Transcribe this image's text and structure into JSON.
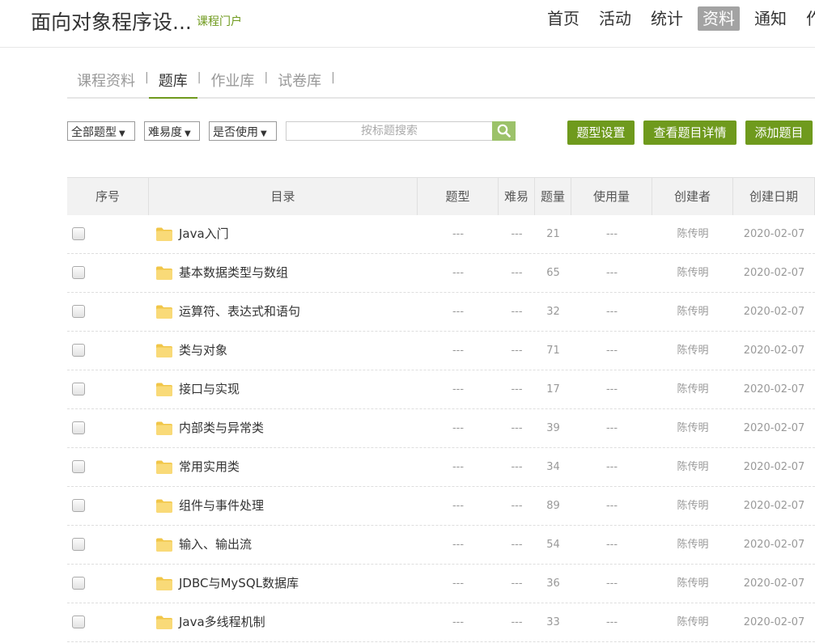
{
  "header": {
    "course_title": "面向对象程序设...",
    "portal_link": "课程门户",
    "nav": [
      "首页",
      "活动",
      "统计",
      "资料",
      "通知",
      "作"
    ],
    "active_nav": 3
  },
  "subtabs": {
    "items": [
      "课程资料",
      "题库",
      "作业库",
      "试卷库"
    ],
    "separator": "|",
    "active": 1
  },
  "filters": {
    "type_select": "全部题型",
    "difficulty_select": "难易度",
    "usage_select": "是否使用",
    "caret": "▼",
    "search_placeholder": "按标题搜索"
  },
  "actions": {
    "type_settings": "题型设置",
    "view_details": "查看题目详情",
    "add_question": "添加题目"
  },
  "table": {
    "columns": [
      "序号",
      "目录",
      "题型",
      "难易",
      "题量",
      "使用量",
      "创建者",
      "创建日期"
    ],
    "rows": [
      {
        "name": "Java入门",
        "type": "---",
        "difficulty": "---",
        "count": "21",
        "usage": "---",
        "creator": "陈传明",
        "date": "2020-02-07"
      },
      {
        "name": "基本数据类型与数组",
        "type": "---",
        "difficulty": "---",
        "count": "65",
        "usage": "---",
        "creator": "陈传明",
        "date": "2020-02-07"
      },
      {
        "name": "运算符、表达式和语句",
        "type": "---",
        "difficulty": "---",
        "count": "32",
        "usage": "---",
        "creator": "陈传明",
        "date": "2020-02-07"
      },
      {
        "name": "类与对象",
        "type": "---",
        "difficulty": "---",
        "count": "71",
        "usage": "---",
        "creator": "陈传明",
        "date": "2020-02-07"
      },
      {
        "name": "接口与实现",
        "type": "---",
        "difficulty": "---",
        "count": "17",
        "usage": "---",
        "creator": "陈传明",
        "date": "2020-02-07"
      },
      {
        "name": "内部类与异常类",
        "type": "---",
        "difficulty": "---",
        "count": "39",
        "usage": "---",
        "creator": "陈传明",
        "date": "2020-02-07"
      },
      {
        "name": "常用实用类",
        "type": "---",
        "difficulty": "---",
        "count": "34",
        "usage": "---",
        "creator": "陈传明",
        "date": "2020-02-07"
      },
      {
        "name": "组件与事件处理",
        "type": "---",
        "difficulty": "---",
        "count": "89",
        "usage": "---",
        "creator": "陈传明",
        "date": "2020-02-07"
      },
      {
        "name": "输入、输出流",
        "type": "---",
        "difficulty": "---",
        "count": "54",
        "usage": "---",
        "creator": "陈传明",
        "date": "2020-02-07"
      },
      {
        "name": "JDBC与MySQL数据库",
        "type": "---",
        "difficulty": "---",
        "count": "36",
        "usage": "---",
        "creator": "陈传明",
        "date": "2020-02-07"
      },
      {
        "name": "Java多线程机制",
        "type": "---",
        "difficulty": "---",
        "count": "33",
        "usage": "---",
        "creator": "陈传明",
        "date": "2020-02-07"
      }
    ]
  },
  "icons": {
    "search": "search-icon",
    "folder": "folder-icon",
    "checkbox": "checkbox-icon"
  },
  "colors": {
    "accent_green": "#6f9a1d",
    "search_button": "#9cc26a",
    "active_nav_bg": "#a3a3a3",
    "folder_yellow": "#f7d56a"
  }
}
